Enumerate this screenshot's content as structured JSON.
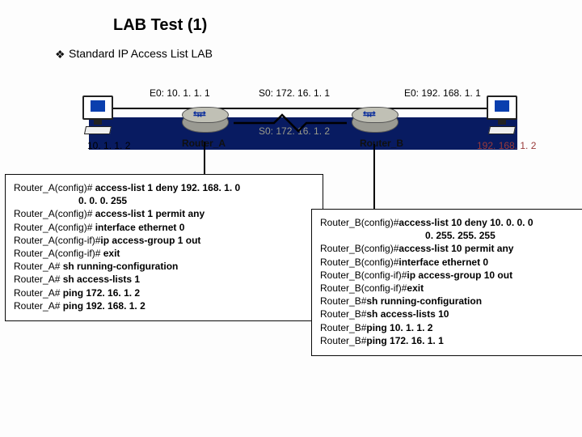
{
  "title": "LAB Test (1)",
  "subtitle": "Standard IP Access List LAB",
  "bullet": "❖",
  "labels": {
    "e0_left": "E0: 10. 1. 1. 1",
    "s0": "S0: 172. 16. 1. 1",
    "e0_right": "E0: 192. 168. 1. 1",
    "host_left": "10. 1. 1. 2",
    "s0_under": "S0: 172. 16. 1. 2",
    "host_right": "192. 168. 1. 2",
    "router_a": "Router_A",
    "router_b": "Router_B"
  },
  "cfgA": {
    "lines": [
      {
        "pre": "Router_A(config)# ",
        "cmd": "access-list 1 deny 192. 168. 1. 0"
      },
      {
        "pre": "                        ",
        "cmd": "0. 0. 0. 255"
      },
      {
        "pre": "Router_A(config)# ",
        "cmd": "access-list 1 permit any"
      },
      {
        "pre": "Router_A(config)# ",
        "cmd": "interface ethernet 0"
      },
      {
        "pre": "Router_A(config-if)#",
        "cmd": "ip access-group 1 out"
      },
      {
        "pre": "Router_A(config-if)# ",
        "cmd": "exit"
      },
      {
        "pre": "Router_A# ",
        "cmd": "sh running-configuration"
      },
      {
        "pre": "Router_A# ",
        "cmd": "sh access-lists 1"
      },
      {
        "pre": "Router_A# ",
        "cmd": "ping 172. 16. 1. 2"
      },
      {
        "pre": "Router_A# ",
        "cmd": "ping 192. 168. 1. 2"
      }
    ]
  },
  "cfgB": {
    "lines": [
      {
        "pre": "Router_B(config)#",
        "cmd": "access-list 10 deny 10. 0. 0. 0"
      },
      {
        "pre": "                                       ",
        "cmd": "0. 255. 255. 255"
      },
      {
        "pre": "Router_B(config)#",
        "cmd": "access-list 10 permit any"
      },
      {
        "pre": "Router_B(config)#",
        "cmd": "interface ethernet 0"
      },
      {
        "pre": "Router_B(config-if)#",
        "cmd": "ip access-group 10 out"
      },
      {
        "pre": "Router_B(config-if)#",
        "cmd": "exit"
      },
      {
        "pre": "Router_B#",
        "cmd": "sh running-configuration"
      },
      {
        "pre": "Router_B#",
        "cmd": "sh access-lists 10"
      },
      {
        "pre": "Router_B#",
        "cmd": "ping 10. 1. 1. 2"
      },
      {
        "pre": "Router_B#",
        "cmd": "ping 172. 16. 1. 1"
      }
    ]
  }
}
